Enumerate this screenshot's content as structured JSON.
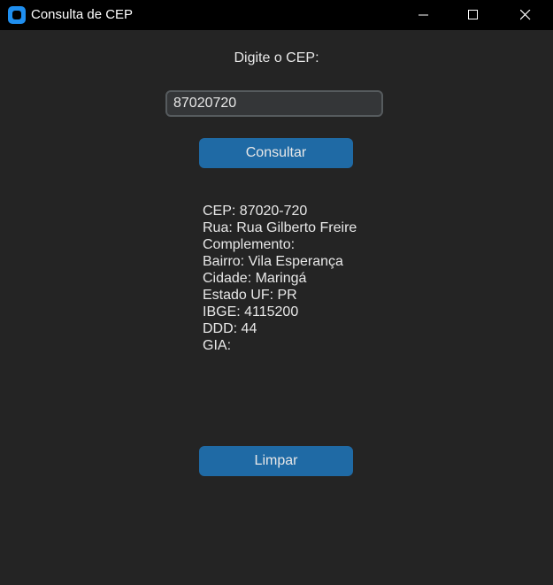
{
  "window": {
    "title": "Consulta de CEP"
  },
  "form": {
    "label": "Digite o CEP:",
    "cep_value": "87020720",
    "consultar_label": "Consultar",
    "limpar_label": "Limpar"
  },
  "result": {
    "lines": [
      "CEP: 87020-720",
      "Rua: Rua Gilberto Freire",
      "Complemento:",
      "Bairro: Vila Esperança",
      "Cidade: Maringá",
      "Estado UF: PR",
      "IBGE: 4115200",
      "DDD: 44",
      "GIA:"
    ]
  },
  "colors": {
    "background": "#242424",
    "titlebar": "#000000",
    "button": "#1f6aa5",
    "input_bg": "#343638",
    "input_border": "#565b5e",
    "text": "#e8e8e8",
    "app_icon": "#1f8ff0"
  }
}
